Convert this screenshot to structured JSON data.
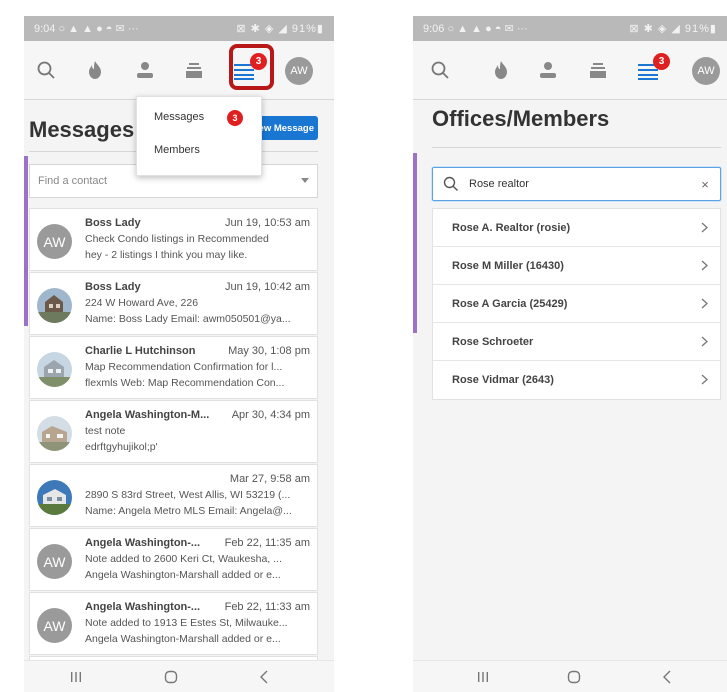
{
  "left_screen": {
    "status": {
      "time": "9:04",
      "left_icons": "○ ▲ ▲ ● ◓ ✉ ···",
      "right_icons": "⊠ ✱ ◈ ◢ 91%▮"
    },
    "nav": {
      "menu_badge": "3",
      "avatar_initials": "AW",
      "active_color": "#1976d2"
    },
    "page_title": "Messages",
    "new_message_label": "New Message",
    "dropdown": {
      "items": [
        "Messages",
        "Members"
      ],
      "messages_badge": "3"
    },
    "find_contact_placeholder": "Find a contact",
    "messages": [
      {
        "avatar": "AW",
        "name": "Boss Lady",
        "date": "Jun 19, 10:53 am",
        "line1": "Check Condo listings in Recommended",
        "line2": "hey - 2 listings I think you may like."
      },
      {
        "avatar": "house-photo",
        "name": "Boss Lady",
        "date": "Jun 19, 10:42 am",
        "line1": "224 W Howard Ave, 226",
        "line2": "Name: Boss Lady Email: awm050501@ya..."
      },
      {
        "avatar": "house-photo",
        "name": "Charlie L Hutchinson",
        "date": "May 30, 1:08 pm",
        "line1": "Map Recommendation Confirmation for l...",
        "line2": "flexmls Web: Map Recommendation Con..."
      },
      {
        "avatar": "house-photo",
        "name": "Angela Washington-M...",
        "date": "Apr 30, 4:34 pm",
        "line1": "test note",
        "line2": "edrftgyhujikol;p'"
      },
      {
        "avatar": "house-photo",
        "name": "",
        "date": "Mar 27, 9:58 am",
        "line1": "2890 S 83rd Street, West Allis, WI 53219 (...",
        "line2": "Name: Angela Metro MLS Email: Angela@..."
      },
      {
        "avatar": "AW",
        "name": "Angela Washington-...",
        "date": "Feb 22, 11:35 am",
        "line1": "Note added to 2600 Keri Ct, Waukesha, ...",
        "line2": "Angela Washington-Marshall added or e..."
      },
      {
        "avatar": "AW",
        "name": "Angela Washington-...",
        "date": "Feb 22, 11:33 am",
        "line1": "Note added to 1913 E Estes St, Milwauke...",
        "line2": "Angela Washington-Marshall added or e..."
      }
    ]
  },
  "right_screen": {
    "status": {
      "time": "9:06",
      "left_icons": "○ ▲ ▲ ● ◓ ✉ ···",
      "right_icons": "⊠ ✱ ◈ ◢ 91%▮"
    },
    "nav": {
      "menu_badge": "3",
      "avatar_initials": "AW"
    },
    "page_title": "Offices/Members",
    "search_value": "Rose realtor",
    "clear_symbol": "×",
    "results": [
      "Rose A. Realtor (rosie)",
      "Rose M Miller (16430)",
      "Rose A Garcia (25429)",
      "Rose Schroeter",
      "Rose Vidmar (2643)"
    ]
  },
  "colors": {
    "accent_blue": "#1976d2",
    "badge_red": "#e02020",
    "highlight_red": "#b81818",
    "side_accent_purple": "#9b72c8"
  }
}
